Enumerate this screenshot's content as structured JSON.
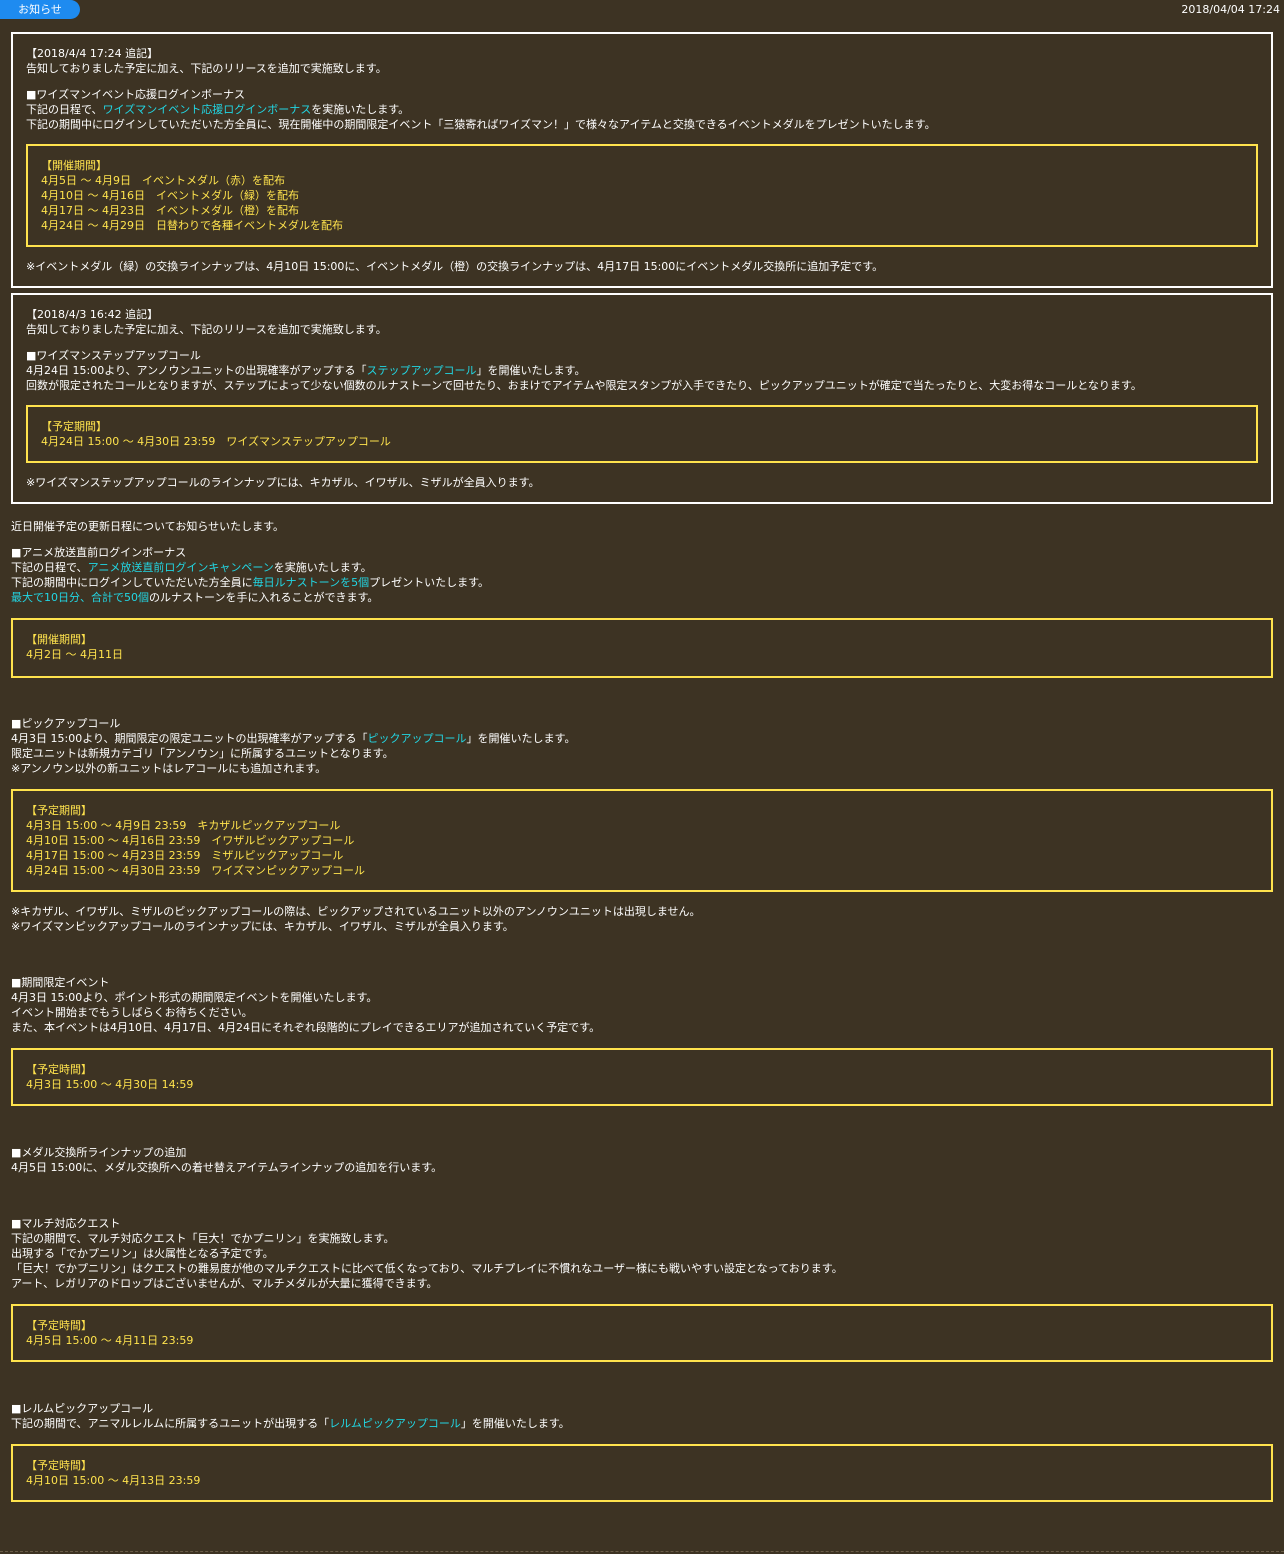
{
  "header": {
    "badge": "お知らせ",
    "date": "2018/04/04 17:24"
  },
  "update1": {
    "stamp": "【2018/4/4 17:24 追記】",
    "intro": "告知しておりました予定に加え、下記のリリースを追加で実施致します。",
    "heading": "■ワイズマンイベント応援ログインボーナス",
    "line1_pre": "下記の日程で、",
    "line1_link": "ワイズマンイベント応援ログインボーナス",
    "line1_post": "を実施いたします。",
    "line2": "下記の期間中にログインしていただいた方全員に、現在開催中の期間限定イベント「三猿寄ればワイズマン！」で様々なアイテムと交換できるイベントメダルをプレゼントいたします。",
    "box_title": "【開催期間】",
    "box_lines": [
      "4月5日 ～ 4月9日　イベントメダル（赤）を配布",
      "4月10日 ～ 4月16日　イベントメダル（緑）を配布",
      "4月17日 ～ 4月23日　イベントメダル（橙）を配布",
      "4月24日 ～ 4月29日　日替わりで各種イベントメダルを配布"
    ],
    "note": "※イベントメダル（緑）の交換ラインナップは、4月10日 15:00に、イベントメダル（橙）の交換ラインナップは、4月17日 15:00にイベントメダル交換所に追加予定です。"
  },
  "update2": {
    "stamp": "【2018/4/3 16:42 追記】",
    "intro": "告知しておりました予定に加え、下記のリリースを追加で実施致します。",
    "heading": "■ワイズマンステップアップコール",
    "line1_pre": "4月24日 15:00より、アンノウンユニットの出現確率がアップする「",
    "line1_link": "ステップアップコール",
    "line1_post": "」を開催いたします。",
    "line2": "回数が限定されたコールとなりますが、ステップによって少ない個数のルナストーンで回せたり、おまけでアイテムや限定スタンプが入手できたり、ピックアップユニットが確定で当たったりと、大変お得なコールとなります。",
    "box_title": "【予定期間】",
    "box_lines": [
      "4月24日 15:00 ～ 4月30日 23:59　ワイズマンステップアップコール"
    ],
    "note": "※ワイズマンステップアップコールのラインナップには、キカザル、イワザル、ミザルが全員入ります。"
  },
  "intro_text": "近日開催予定の更新日程についてお知らせいたします。",
  "anime": {
    "heading": "■アニメ放送直前ログインボーナス",
    "line1_pre": "下記の日程で、",
    "line1_link": "アニメ放送直前ログインキャンペーン",
    "line1_post": "を実施いたします。",
    "line2_pre": "下記の期間中にログインしていただいた方全員に",
    "line2_link": "毎日ルナストーンを5個",
    "line2_post": "プレゼントいたします。",
    "line3_link": "最大で10日分、合計で50個",
    "line3_post": "のルナストーンを手に入れることができます。",
    "box_title": "【開催期間】",
    "box_lines": [
      "4月2日 ～ 4月11日"
    ]
  },
  "pickup": {
    "heading": "■ピックアップコール",
    "line1_pre": "4月3日 15:00より、期間限定の限定ユニットの出現確率がアップする「",
    "line1_link": "ピックアップコール",
    "line1_post": "」を開催いたします。",
    "line2": "限定ユニットは新規カテゴリ「アンノウン」に所属するユニットとなります。",
    "line3": "※アンノウン以外の新ユニットはレアコールにも追加されます。",
    "box_title": "【予定期間】",
    "box_lines": [
      "4月3日 15:00 ～ 4月9日 23:59　キカザルピックアップコール",
      "4月10日 15:00 ～ 4月16日 23:59　イワザルピックアップコール",
      "4月17日 15:00 ～ 4月23日 23:59　ミザルピックアップコール",
      "4月24日 15:00 ～ 4月30日 23:59　ワイズマンピックアップコール"
    ],
    "note1": "※キカザル、イワザル、ミザルのピックアップコールの際は、ピックアップされているユニット以外のアンノウンユニットは出現しません。",
    "note2": "※ワイズマンピックアップコールのラインナップには、キカザル、イワザル、ミザルが全員入ります。"
  },
  "event": {
    "heading": "■期間限定イベント",
    "line1": "4月3日 15:00より、ポイント形式の期間限定イベントを開催いたします。",
    "line2": "イベント開始までもうしばらくお待ちください。",
    "line3": "また、本イベントは4月10日、4月17日、4月24日にそれぞれ段階的にプレイできるエリアが追加されていく予定です。",
    "box_title": "【予定時間】",
    "box_lines": [
      "4月3日 15:00 ～ 4月30日 14:59"
    ]
  },
  "medal": {
    "heading": "■メダル交換所ラインナップの追加",
    "line1": "4月5日 15:00に、メダル交換所への着せ替えアイテムラインナップの追加を行います。"
  },
  "multi": {
    "heading": "■マルチ対応クエスト",
    "line1": "下記の期間で、マルチ対応クエスト「巨大！でかプニリン」を実施致します。",
    "line2": "出現する「でかプニリン」は火属性となる予定です。",
    "line3": "「巨大！でかプニリン」はクエストの難易度が他のマルチクエストに比べて低くなっており、マルチプレイに不慣れなユーザー様にも戦いやすい設定となっております。",
    "line4": "アート、レガリアのドロップはございませんが、マルチメダルが大量に獲得できます。",
    "box_title": "【予定時間】",
    "box_lines": [
      "4月5日 15:00 ～ 4月11日 23:59"
    ]
  },
  "relm": {
    "heading": "■レルムピックアップコール",
    "line1_pre": "下記の期間で、アニマルレルムに所属するユニットが出現する「",
    "line1_link": "レルムピックアップコール",
    "line1_post": "」を開催いたします。",
    "box_title": "【予定時間】",
    "box_lines": [
      "4月10日 15:00 ～ 4月13日 23:59"
    ]
  }
}
